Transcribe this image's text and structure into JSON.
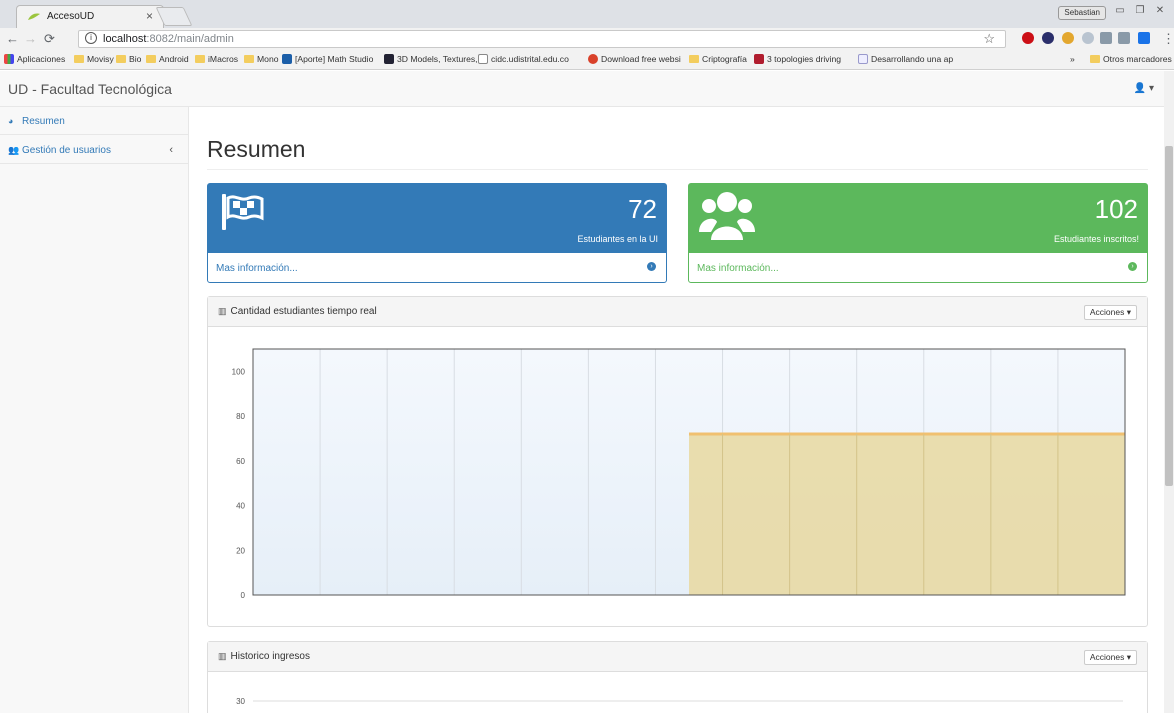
{
  "browser": {
    "tab_title": "AccesoUD",
    "url_host": "localhost",
    "url_path": ":8082/main/admin",
    "profile_name": "Sebastian",
    "bookmarks": [
      {
        "label": "Aplicaciones",
        "icon": "apps-grid-icon"
      },
      {
        "label": "Movisy",
        "icon": "folder-icon"
      },
      {
        "label": "Bio",
        "icon": "folder-icon"
      },
      {
        "label": "Android",
        "icon": "folder-icon"
      },
      {
        "label": "iMacros",
        "icon": "folder-icon"
      },
      {
        "label": "Mono",
        "icon": "folder-icon"
      },
      {
        "label": "[Aporte] Math Studio",
        "icon": "site-icon"
      },
      {
        "label": "3D Models, Textures,",
        "icon": "site-icon"
      },
      {
        "label": "cidc.udistrital.edu.co",
        "icon": "page-icon"
      },
      {
        "label": "Download free websi",
        "icon": "site-icon"
      },
      {
        "label": "Criptografía",
        "icon": "folder-icon"
      },
      {
        "label": "3 topologies driving",
        "icon": "site-icon"
      },
      {
        "label": "Desarrollando una ap",
        "icon": "site-icon"
      },
      {
        "label": "Otros marcadores",
        "icon": "folder-icon"
      }
    ],
    "overflow": "»"
  },
  "app": {
    "brand": "UD - Facultad Tecnológica",
    "user_icon": "user-icon",
    "sidebar": [
      {
        "label": "Resumen",
        "icon": "dashboard-icon"
      },
      {
        "label": "Gestión de usuarios",
        "icon": "users-icon",
        "chevron": "‹"
      }
    ],
    "page_title": "Resumen",
    "stats": [
      {
        "value": "72",
        "label": "Estudiantes en la UI",
        "link": "Mas información...",
        "color": "#337ab7",
        "icon": "flag-checkered-icon"
      },
      {
        "value": "102",
        "label": "Estudiantes inscritos!",
        "link": "Mas información...",
        "color": "#5cb85c",
        "icon": "users-icon"
      }
    ],
    "panels": [
      {
        "title": "Cantidad estudiantes tiempo real",
        "actions": "Acciones ▾"
      },
      {
        "title": "Historico ingresos",
        "actions": "Acciones ▾"
      }
    ]
  },
  "chart_data": [
    {
      "type": "area",
      "title": "Cantidad estudiantes tiempo real",
      "ylim": [
        0,
        110
      ],
      "yticks": [
        0,
        20,
        40,
        60,
        80,
        100
      ],
      "grid": true,
      "series_color": "#e8d8a0",
      "line_color": "#f0c070",
      "x_segments": 13,
      "area_start_segment": 6.5,
      "value": 72
    },
    {
      "type": "line",
      "title": "Historico ingresos",
      "yticks_visible": [
        30
      ],
      "grid": true
    }
  ]
}
